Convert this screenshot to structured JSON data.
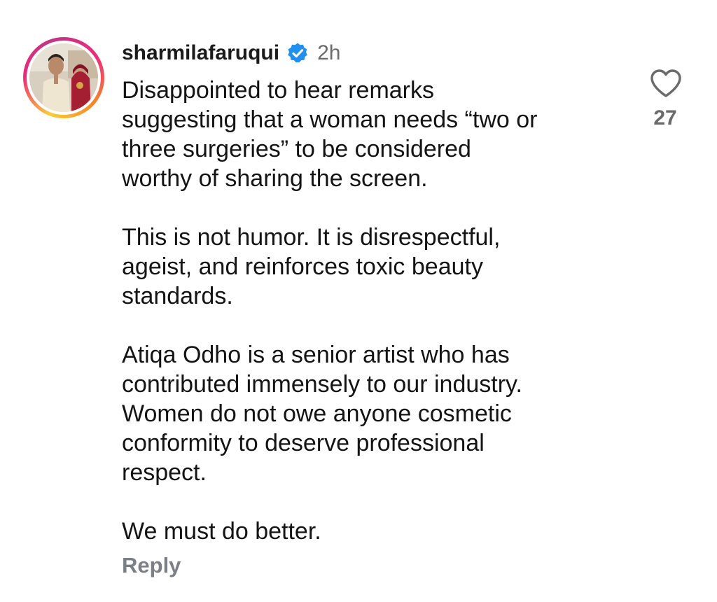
{
  "comment": {
    "username": "sharmilafaruqui",
    "verified_icon": "verified-badge-icon",
    "timestamp": "2h",
    "paragraphs": [
      {
        "lines": [
          "Disappointed to hear remarks",
          "suggesting that a woman needs “two or",
          "three surgeries” to be considered",
          "worthy of sharing the screen."
        ]
      },
      {
        "lines": [
          "This is not humor. It is disrespectful,",
          "ageist, and reinforces toxic beauty",
          "standards."
        ]
      },
      {
        "lines": [
          "Atiqa Odho is a senior artist who has",
          "contributed immensely to our industry.",
          "Women do not owe anyone cosmetic",
          "conformity to deserve professional",
          "respect."
        ]
      },
      {
        "lines": [
          "We must do better."
        ]
      }
    ],
    "reply_label": "Reply",
    "like_icon": "heart-outline-icon",
    "like_count": "27"
  },
  "colors": {
    "verified_blue": "#1f8ff0",
    "secondary_text": "#6a6a6a",
    "story_ring": [
      "#f9ce34",
      "#ee2a7b",
      "#c13584"
    ]
  }
}
